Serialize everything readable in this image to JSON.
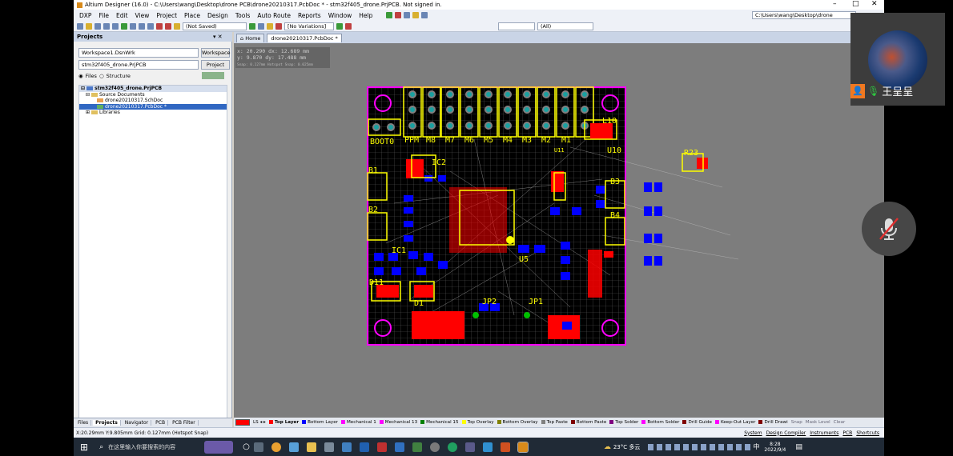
{
  "window": {
    "title": "Altium Designer (16.0) - C:\\Users\\wang\\Desktop\\drone PCB\\drone20210317.PcbDoc * - stm32f405_drone.PrjPCB. Not signed in.",
    "path_combo": "C:\\Users\\wang\\Desktop\\drone"
  },
  "menu": [
    {
      "label": "DXP"
    },
    {
      "label": "File"
    },
    {
      "label": "Edit"
    },
    {
      "label": "View"
    },
    {
      "label": "Project"
    },
    {
      "label": "Place"
    },
    {
      "label": "Design"
    },
    {
      "label": "Tools"
    },
    {
      "label": "Auto Route"
    },
    {
      "label": "Reports"
    },
    {
      "label": "Window"
    },
    {
      "label": "Help"
    }
  ],
  "toolbar": {
    "saved_state": "(Not Saved)",
    "variations": "[No Variations]",
    "filter": "(All)"
  },
  "projects_panel": {
    "title": "Projects",
    "workspace_value": "Workspace1.DsnWrk",
    "workspace_button": "Workspace",
    "project_value": "stm32f405_drone.PrjPCB",
    "project_button": "Project",
    "view_files": "Files",
    "view_structure": "Structure",
    "tree": {
      "project": "stm32f405_drone.PrjPCB",
      "source_folder": "Source Documents",
      "schdoc": "drone20210317.SchDoc",
      "pcbdoc": "drone20210317.PcbDoc *",
      "libraries": "Libraries"
    },
    "tabs": [
      "Files",
      "Projects",
      "Navigator",
      "PCB",
      "PCB Filter"
    ]
  },
  "doc_tabs": [
    {
      "label": "Home"
    },
    {
      "label": "drone20210317.PcbDoc *"
    }
  ],
  "hud": {
    "line1": "x: 20.290   dx: 12.689 mm",
    "line2": "y:  9.870   dy: 17.488 mm",
    "line3": "Snap: 0.127mm Hotspot Snap: 0.025mm"
  },
  "pcb_labels": {
    "boot": "BOOT0",
    "ppm": "PPM",
    "motors": [
      "M8",
      "M7",
      "M6",
      "M5",
      "M4",
      "M3",
      "M2",
      "M1"
    ],
    "l10": "L10",
    "u10": "U10",
    "ic2": "IC2",
    "r23": "R23",
    "b1": "B1",
    "b2": "B2",
    "b3": "B3",
    "b4": "B4",
    "u5": "U5",
    "ic1": "IC1",
    "d11": "D11",
    "d1": "D1",
    "jp1": "JP1",
    "jp2": "JP2",
    "u11": "U11"
  },
  "layers": [
    {
      "name": "Top Layer",
      "color": "#ff0000"
    },
    {
      "name": "Bottom Layer",
      "color": "#0000ff"
    },
    {
      "name": "Mechanical 1",
      "color": "#ff00ff"
    },
    {
      "name": "Mechanical 13",
      "color": "#ff00ff"
    },
    {
      "name": "Mechanical 15",
      "color": "#008000"
    },
    {
      "name": "Top Overlay",
      "color": "#ffff00"
    },
    {
      "name": "Bottom Overlay",
      "color": "#808000"
    },
    {
      "name": "Top Paste",
      "color": "#808080"
    },
    {
      "name": "Bottom Paste",
      "color": "#800000"
    },
    {
      "name": "Top Solder",
      "color": "#800080"
    },
    {
      "name": "Bottom Solder",
      "color": "#ff00ff"
    },
    {
      "name": "Drill Guide",
      "color": "#800000"
    },
    {
      "name": "Keep-Out Layer",
      "color": "#ff00ff"
    },
    {
      "name": "Drill Drawi",
      "color": "#800000"
    }
  ],
  "layerbar_right": [
    "Snap",
    "Mask Level",
    "Clear"
  ],
  "status": {
    "left": "X:20.29mm Y:9.805mm   Grid: 0.127mm   (Hotspot Snap)",
    "right": [
      "System",
      "Design Compiler",
      "Instruments",
      "PCB",
      "Shortcuts"
    ]
  },
  "taskbar": {
    "search_placeholder": "在这里输入你要搜索的内容",
    "weather": "23°C 多云",
    "ime": "中",
    "time": "8:28",
    "date": "2022/9/4"
  },
  "meeting": {
    "participant": "王呈呈"
  },
  "colors": {
    "board_bg": "#000000",
    "outline": "#ff00ff",
    "overlay": "#ffff00",
    "top_pad": "#ff0000",
    "bottom_pad": "#0000ff"
  }
}
